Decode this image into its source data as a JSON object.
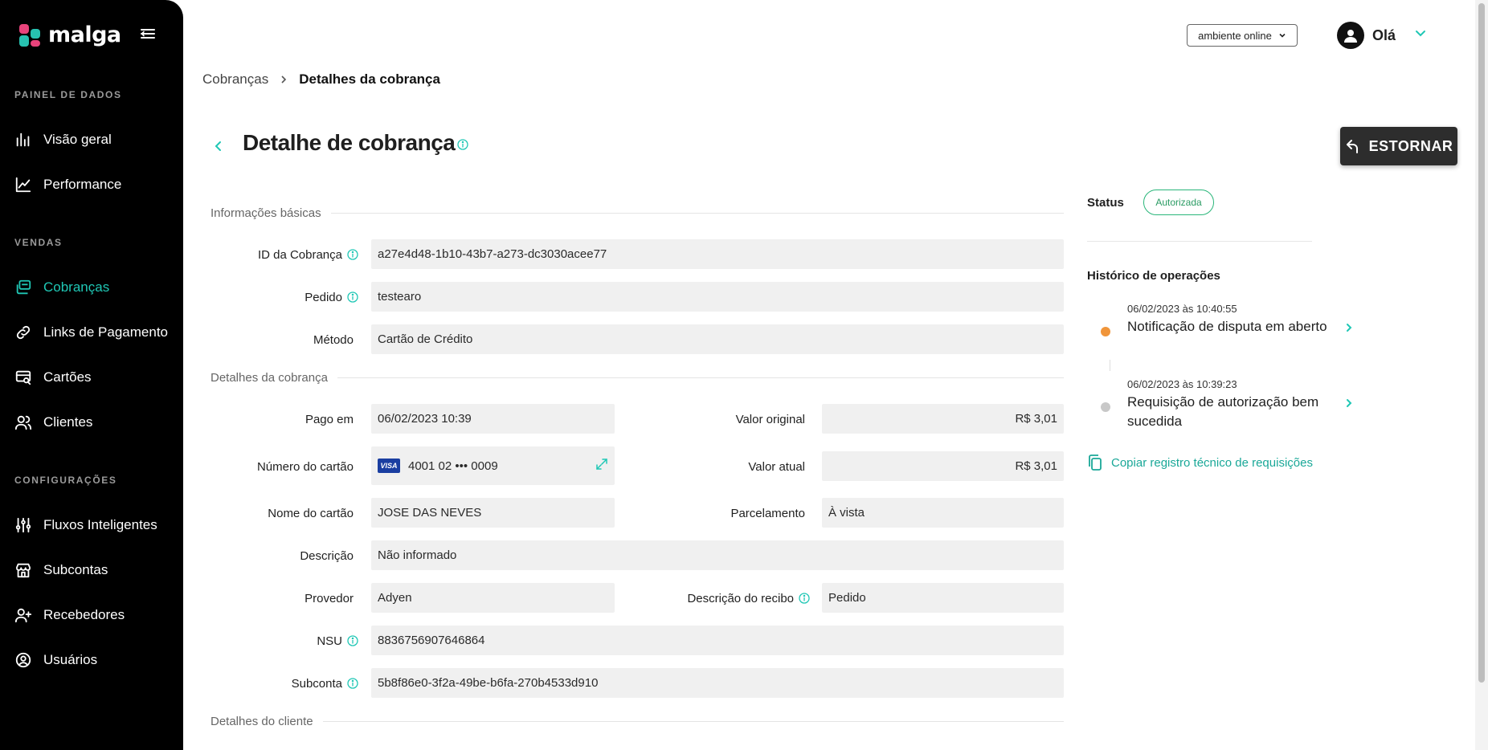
{
  "brand": {
    "name": "malga"
  },
  "sidebar": {
    "sections": [
      {
        "title": "PAINEL DE DADOS"
      },
      {
        "title": "VENDAS"
      },
      {
        "title": "CONFIGURAÇÕES"
      }
    ],
    "items": [
      {
        "label": "Visão geral",
        "icon": "bar-chart-icon"
      },
      {
        "label": "Performance",
        "icon": "line-chart-icon"
      },
      {
        "label": "Cobranças",
        "icon": "charges-icon",
        "active": true
      },
      {
        "label": "Links de Pagamento",
        "icon": "link-icon"
      },
      {
        "label": "Cartões",
        "icon": "card-search-icon"
      },
      {
        "label": "Clientes",
        "icon": "users-icon"
      },
      {
        "label": "Fluxos Inteligentes",
        "icon": "sliders-icon"
      },
      {
        "label": "Subcontas",
        "icon": "store-icon"
      },
      {
        "label": "Recebedores",
        "icon": "user-plus-icon"
      },
      {
        "label": "Usuários",
        "icon": "user-circle-icon"
      }
    ]
  },
  "topbar": {
    "environment": "ambiente online",
    "greeting": "Olá"
  },
  "breadcrumb": {
    "parent": "Cobranças",
    "current": "Detalhes da cobrança"
  },
  "page": {
    "title": "Detalhe de cobrança",
    "refund_label": "ESTORNAR"
  },
  "basic": {
    "heading": "Informações básicas",
    "charge_id_label": "ID da Cobrança",
    "charge_id": "a27e4d48-1b10-43b7-a273-dc3030acee77",
    "order_label": "Pedido",
    "order": "testearo",
    "method_label": "Método",
    "method": "Cartão de Crédito"
  },
  "details": {
    "heading": "Detalhes da cobrança",
    "paid_at_label": "Pago em",
    "paid_at": "06/02/2023 10:39",
    "original_value_label": "Valor original",
    "original_value": "R$ 3,01",
    "card_number_label": "Número do cartão",
    "card_brand": "VISA",
    "card_number": "4001 02 ••• 0009",
    "current_value_label": "Valor atual",
    "current_value": "R$ 3,01",
    "card_name_label": "Nome do cartão",
    "card_name": "JOSE DAS NEVES",
    "installments_label": "Parcelamento",
    "installments": "À vista",
    "description_label": "Descrição",
    "description": "Não informado",
    "provider_label": "Provedor",
    "provider": "Adyen",
    "receipt_desc_label": "Descrição do recibo",
    "receipt_desc": "Pedido",
    "nsu_label": "NSU",
    "nsu": "8836756907646864",
    "subaccount_label": "Subconta",
    "subaccount": "5b8f86e0-3f2a-49be-b6fa-270b4533d910"
  },
  "customer": {
    "heading": "Detalhes do cliente"
  },
  "status": {
    "label": "Status",
    "value": "Autorizada",
    "color": "#2ab67a"
  },
  "history": {
    "title": "Histórico de operações",
    "items": [
      {
        "date": "06/02/2023 às 10:40:55",
        "text": "Notificação de disputa em aberto",
        "dot_color": "#f0953a"
      },
      {
        "date": "06/02/2023 às 10:39:23",
        "text": "Requisição de autorização bem sucedida",
        "dot_color": "#c8c8c8"
      }
    ],
    "copy_label": "Copiar registro técnico de requisições"
  },
  "colors": {
    "accent": "#1fc7b5",
    "sidebar_bg": "#000000",
    "field_bg": "#f0f0f0"
  }
}
